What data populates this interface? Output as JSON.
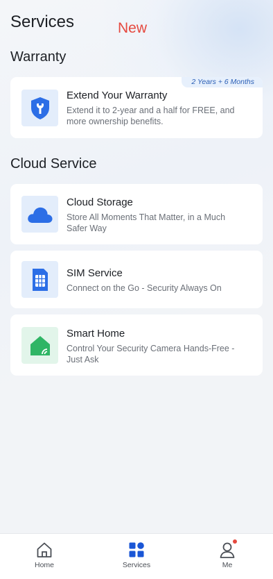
{
  "header": {
    "title": "Services",
    "new_label": "New"
  },
  "warranty": {
    "section_title": "Warranty",
    "card": {
      "badge": "2 Years + 6 Months",
      "title": "Extend Your Warranty",
      "description": "Extend it to 2-year and a half for FREE, and more ownership benefits.",
      "icon": "shield-wrench-icon"
    }
  },
  "cloud_service": {
    "section_title": "Cloud Service",
    "cards": [
      {
        "title": "Cloud Storage",
        "description": "Store All Moments That Matter, in a Much Safer Way",
        "icon": "cloud-icon"
      },
      {
        "title": "SIM Service",
        "description": "Connect on the Go - Security Always On",
        "icon": "sim-card-icon"
      },
      {
        "title": "Smart Home",
        "description": "Control Your Security Camera Hands-Free - Just Ask",
        "icon": "smart-home-icon"
      }
    ]
  },
  "tabbar": {
    "tabs": [
      {
        "label": "Home",
        "icon": "home-icon"
      },
      {
        "label": "Services",
        "icon": "services-grid-icon",
        "active": true
      },
      {
        "label": "Me",
        "icon": "user-icon",
        "notification_dot": true
      }
    ]
  },
  "colors": {
    "accent": "#1a56d6",
    "new_tag": "#e5493f",
    "smart_home_green": "#2fb565",
    "badge_bg": "#e7f0fc"
  }
}
